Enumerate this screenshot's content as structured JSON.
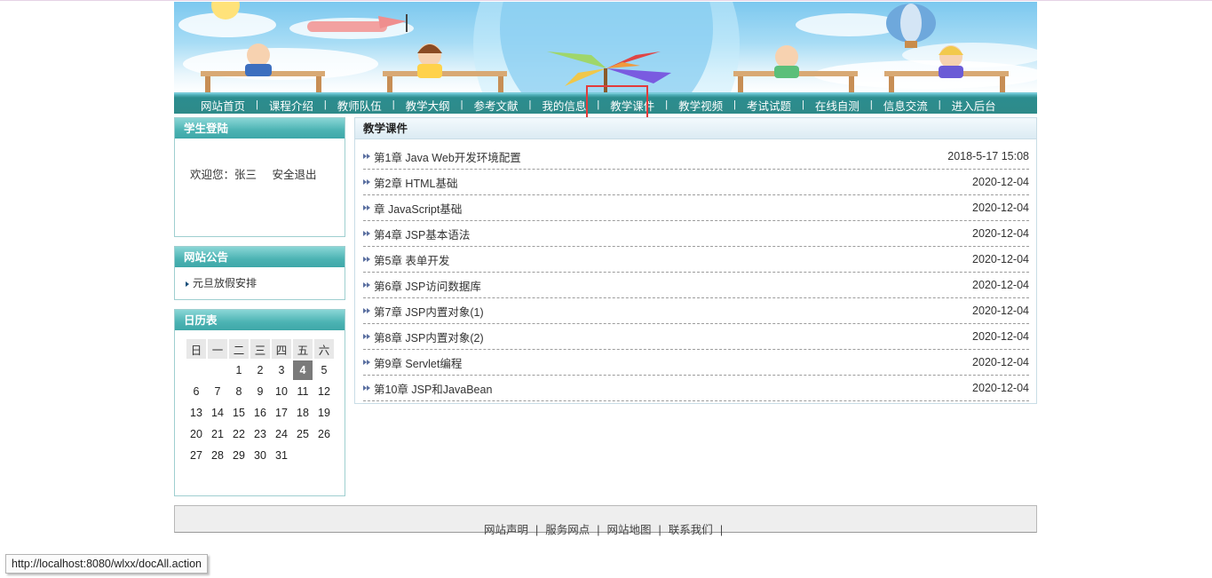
{
  "nav": {
    "items": [
      "网站首页",
      "课程介绍",
      "教师队伍",
      "教学大纲",
      "参考文献",
      "我的信息",
      "教学课件",
      "教学视频",
      "考试试题",
      "在线自测",
      "信息交流",
      "进入后台"
    ],
    "separator": "|",
    "active": "教学课件"
  },
  "login": {
    "title": "学生登陆",
    "welcome": "欢迎您：张三",
    "logout": "安全退出"
  },
  "notice": {
    "title": "网站公告",
    "items": [
      "元旦放假安排"
    ]
  },
  "calendar": {
    "title": "日历表",
    "weekdays": [
      "日",
      "一",
      "二",
      "三",
      "四",
      "五",
      "六"
    ],
    "weeks": [
      [
        "",
        "",
        "",
        "1",
        "2",
        "3",
        "4",
        "5"
      ],
      [
        "6",
        "7",
        "8",
        "9",
        "10",
        "11",
        "12"
      ],
      [
        "13",
        "14",
        "15",
        "16",
        "17",
        "18",
        "19"
      ],
      [
        "20",
        "21",
        "22",
        "23",
        "24",
        "25",
        "26"
      ],
      [
        "27",
        "28",
        "29",
        "30",
        "31",
        "",
        ""
      ]
    ],
    "today": "4"
  },
  "main": {
    "title": "教学课件",
    "rows": [
      {
        "title": "第1章 Java Web开发环境配置",
        "date": "2018-5-17 15:08"
      },
      {
        "title": "第2章 HTML基础",
        "date": "2020-12-04"
      },
      {
        "title": "章 JavaScript基础",
        "date": "2020-12-04"
      },
      {
        "title": "第4章 JSP基本语法",
        "date": "2020-12-04"
      },
      {
        "title": "第5章 表单开发",
        "date": "2020-12-04"
      },
      {
        "title": "第6章 JSP访问数据库",
        "date": "2020-12-04"
      },
      {
        "title": "第7章 JSP内置对象(1)",
        "date": "2020-12-04"
      },
      {
        "title": "第8章 JSP内置对象(2)",
        "date": "2020-12-04"
      },
      {
        "title": "第9章 Servlet编程",
        "date": "2020-12-04"
      },
      {
        "title": "第10章 JSP和JavaBean",
        "date": "2020-12-04"
      }
    ]
  },
  "footer": {
    "links": [
      "网站声明",
      "服务网点",
      "网站地图",
      "联系我们"
    ]
  },
  "status_url": "http://localhost:8080/wlxx/docAll.action",
  "colors": {
    "nav_bg": "#2e8a89",
    "panel_head": "#4cb3b3",
    "highlight": "#e23b3b"
  }
}
